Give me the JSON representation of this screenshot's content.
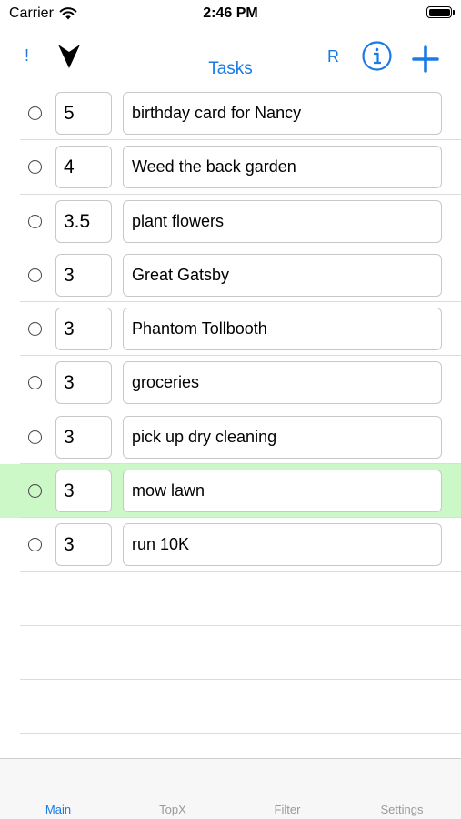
{
  "status_bar": {
    "carrier": "Carrier",
    "time": "2:46 PM",
    "wifi_icon": "wifi-icon",
    "battery_icon": "battery-icon"
  },
  "nav": {
    "bang_label": "!",
    "sort_icon": "triangle-down-icon",
    "title": "Tasks",
    "r_label": "R",
    "info_icon": "info-circle-icon",
    "add_icon": "plus-icon",
    "accent_color": "#1a7be6"
  },
  "tasks": [
    {
      "priority": "5",
      "name": "birthday card for Nancy",
      "highlighted": false
    },
    {
      "priority": "4",
      "name": "Weed the back garden",
      "highlighted": false
    },
    {
      "priority": "3.5",
      "name": "plant flowers",
      "highlighted": false
    },
    {
      "priority": "3",
      "name": "Great Gatsby",
      "highlighted": false
    },
    {
      "priority": "3",
      "name": "Phantom Tollbooth",
      "highlighted": false
    },
    {
      "priority": "3",
      "name": "groceries",
      "highlighted": false
    },
    {
      "priority": "3",
      "name": "pick up dry cleaning",
      "highlighted": false
    },
    {
      "priority": "3",
      "name": "mow lawn",
      "highlighted": true
    },
    {
      "priority": "3",
      "name": "run 10K",
      "highlighted": false
    }
  ],
  "highlight_color": "#ccf7c6",
  "tab_bar": {
    "tabs": [
      {
        "label": "Main",
        "active": true
      },
      {
        "label": "TopX",
        "active": false
      },
      {
        "label": "Filter",
        "active": false
      },
      {
        "label": "Settings",
        "active": false
      }
    ]
  }
}
